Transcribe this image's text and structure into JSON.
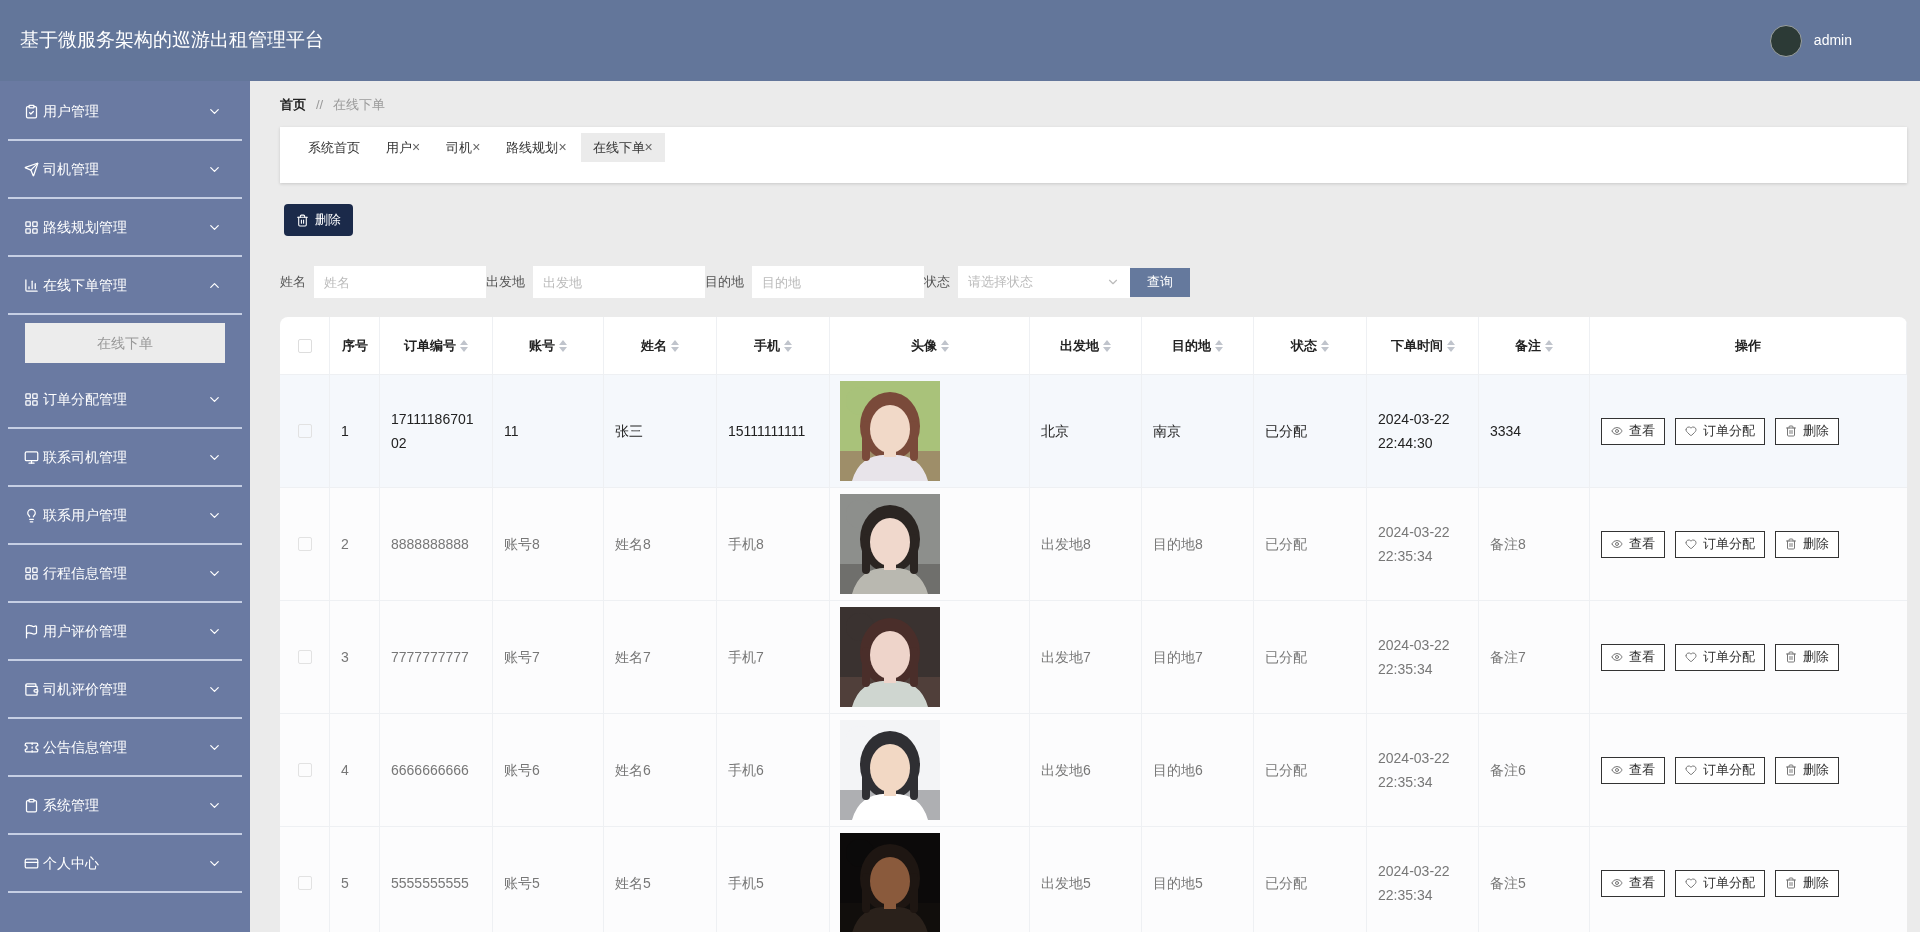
{
  "header": {
    "title": "基于微服务架构的巡游出租管理平台",
    "user": "admin"
  },
  "sidebar": {
    "items": [
      {
        "label": "用户管理",
        "expanded": false
      },
      {
        "label": "司机管理",
        "expanded": false
      },
      {
        "label": "路线规划管理",
        "expanded": false
      },
      {
        "label": "在线下单管理",
        "expanded": true,
        "children": [
          {
            "label": "在线下单",
            "selected": true
          }
        ]
      },
      {
        "label": "订单分配管理",
        "expanded": false
      },
      {
        "label": "联系司机管理",
        "expanded": false
      },
      {
        "label": "联系用户管理",
        "expanded": false
      },
      {
        "label": "行程信息管理",
        "expanded": false
      },
      {
        "label": "用户评价管理",
        "expanded": false
      },
      {
        "label": "司机评价管理",
        "expanded": false
      },
      {
        "label": "公告信息管理",
        "expanded": false
      },
      {
        "label": "系统管理",
        "expanded": false
      },
      {
        "label": "个人中心",
        "expanded": false
      }
    ]
  },
  "breadcrumb": [
    "首页",
    "//",
    "在线下单"
  ],
  "tabs": [
    {
      "label": "系统首页",
      "selected": false
    },
    {
      "label": "用户",
      "selected": false,
      "close": "×"
    },
    {
      "label": "司机",
      "selected": false,
      "close": "×"
    },
    {
      "label": "路线规划",
      "selected": false,
      "close": "×"
    },
    {
      "label": "在线下单",
      "selected": true,
      "close": "×"
    }
  ],
  "toolbar": {
    "delete_button": "删除"
  },
  "filters": [
    {
      "kind": "input",
      "label": "姓名",
      "placeholder": "姓名"
    },
    {
      "kind": "input",
      "label": "出发地",
      "placeholder": "出发地"
    },
    {
      "kind": "input",
      "label": "目的地",
      "placeholder": "目的地"
    },
    {
      "kind": "select",
      "label": "状态",
      "placeholder": "请选择状态"
    }
  ],
  "query_button": "查询",
  "table": {
    "select_all": {
      "checked": false
    },
    "columns": [
      {
        "label": "序号",
        "sortable": false
      },
      {
        "label": "订单编号",
        "sortable": true
      },
      {
        "label": "账号",
        "sortable": true
      },
      {
        "label": "姓名",
        "sortable": true
      },
      {
        "label": "手机",
        "sortable": true
      },
      {
        "label": "头像",
        "sortable": true
      },
      {
        "label": "出发地",
        "sortable": true
      },
      {
        "label": "目的地",
        "sortable": true
      },
      {
        "label": "状态",
        "sortable": true
      },
      {
        "label": "下单时间",
        "sortable": true
      },
      {
        "label": "备注",
        "sortable": true
      },
      {
        "label": "操作",
        "sortable": false
      }
    ],
    "rows": [
      {
        "hovered": true,
        "checked": false,
        "cells": [
          "1",
          "1711118670102",
          "11",
          "张三",
          "15111111111"
        ],
        "avatar": {
          "kind": "picture"
        },
        "cells2": [
          "北京",
          "南京",
          "已分配",
          "2024-03-22 22:44:30",
          "3334"
        ],
        "actions": [
          "查看",
          "订单分配",
          "删除"
        ]
      },
      {
        "hovered": false,
        "checked": false,
        "cells": [
          "2",
          "8888888888",
          "账号8",
          "姓名8",
          "手机8"
        ],
        "avatar": {
          "kind": "picture"
        },
        "cells2": [
          "出发地8",
          "目的地8",
          "已分配",
          "2024-03-22 22:35:34",
          "备注8"
        ],
        "actions": [
          "查看",
          "订单分配",
          "删除"
        ]
      },
      {
        "hovered": false,
        "checked": false,
        "cells": [
          "3",
          "7777777777",
          "账号7",
          "姓名7",
          "手机7"
        ],
        "avatar": {
          "kind": "picture"
        },
        "cells2": [
          "出发地7",
          "目的地7",
          "已分配",
          "2024-03-22 22:35:34",
          "备注7"
        ],
        "actions": [
          "查看",
          "订单分配",
          "删除"
        ]
      },
      {
        "hovered": false,
        "checked": false,
        "cells": [
          "4",
          "6666666666",
          "账号6",
          "姓名6",
          "手机6"
        ],
        "avatar": {
          "kind": "picture"
        },
        "cells2": [
          "出发地6",
          "目的地6",
          "已分配",
          "2024-03-22 22:35:34",
          "备注6"
        ],
        "actions": [
          "查看",
          "订单分配",
          "删除"
        ]
      },
      {
        "hovered": false,
        "checked": false,
        "cells": [
          "5",
          "5555555555",
          "账号5",
          "姓名5",
          "手机5"
        ],
        "avatar": {
          "kind": "picture"
        },
        "cells2": [
          "出发地5",
          "目的地5",
          "已分配",
          "2024-03-22 22:35:34",
          "备注5"
        ],
        "actions": [
          "查看",
          "订单分配",
          "删除"
        ]
      }
    ]
  }
}
